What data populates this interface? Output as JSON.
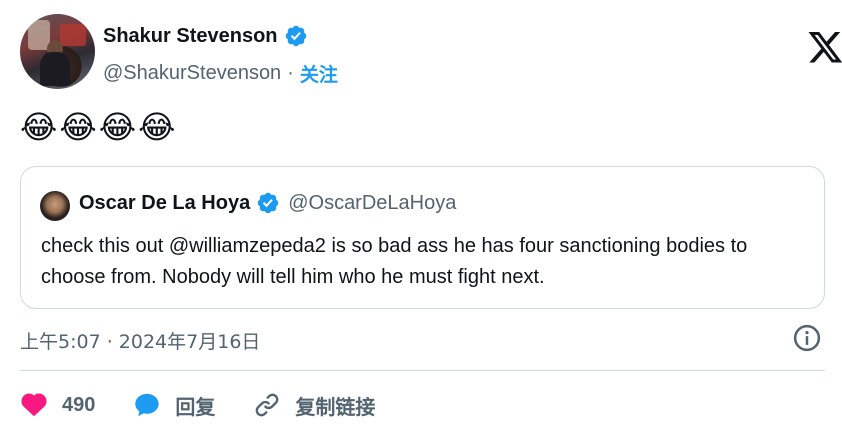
{
  "author": {
    "display_name": "Shakur Stevenson",
    "handle": "@ShakurStevenson",
    "separator": "·",
    "follow_label": "关注",
    "verified": true
  },
  "tweet": {
    "text": "😂😂😂😂"
  },
  "quoted_tweet": {
    "display_name": "Oscar De La Hoya",
    "handle": "@OscarDeLaHoya",
    "verified": true,
    "text": "check this out @williamzepeda2 is  so bad ass he has four sanctioning bodies to choose from. Nobody will tell him who he must fight next."
  },
  "meta": {
    "timestamp": "上午5:07 · 2024年7月16日"
  },
  "actions": {
    "like_count": "490",
    "reply_label": "回复",
    "copy_link_label": "复制链接"
  },
  "icons": {
    "brand": "x-logo-icon",
    "verified": "verified-badge-icon",
    "info": "info-icon",
    "like": "heart-icon",
    "reply": "speech-bubble-icon",
    "copy": "link-icon"
  },
  "colors": {
    "accent": "#1d9bf0",
    "like": "#f91880",
    "text": "#0f1419",
    "secondary": "#536471",
    "border": "#cfd9de"
  }
}
